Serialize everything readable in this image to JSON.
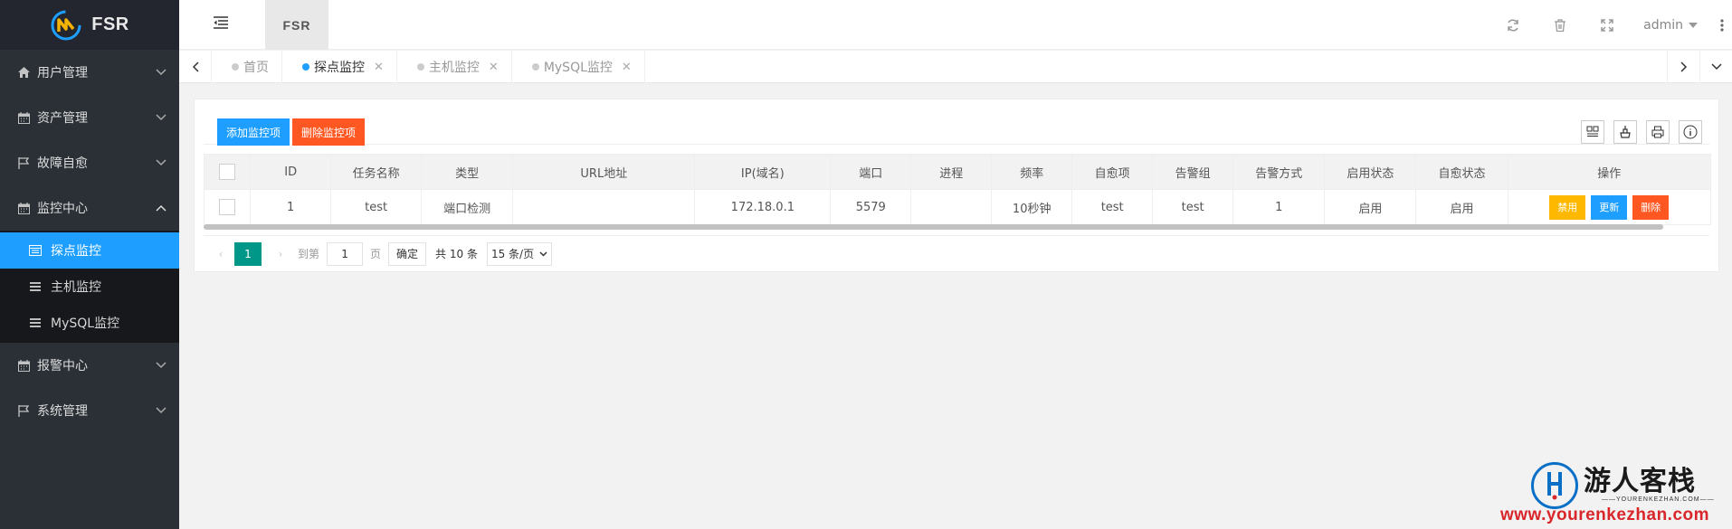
{
  "app": {
    "logo_text": "FSR",
    "site_tab": "FSR"
  },
  "sidebar": {
    "items": [
      {
        "label": "用户管理",
        "icon": "home-icon"
      },
      {
        "label": "资产管理",
        "icon": "calendar-icon"
      },
      {
        "label": "故障自愈",
        "icon": "flag-icon"
      },
      {
        "label": "监控中心",
        "icon": "calendar-icon",
        "expanded": true
      },
      {
        "label": "报警中心",
        "icon": "calendar-icon"
      },
      {
        "label": "系统管理",
        "icon": "flag-icon"
      }
    ],
    "subitems": [
      {
        "label": "探点监控",
        "active": true
      },
      {
        "label": "主机监控"
      },
      {
        "label": "MySQL监控"
      }
    ]
  },
  "header": {
    "user": "admin"
  },
  "tabs": [
    {
      "label": "首页",
      "active": false
    },
    {
      "label": "探点监控",
      "active": true
    },
    {
      "label": "主机监控",
      "active": false
    },
    {
      "label": "MySQL监控",
      "active": false
    }
  ],
  "toolbar": {
    "add_label": "添加监控项",
    "delete_label": "删除监控项"
  },
  "table": {
    "headers": [
      "ID",
      "任务名称",
      "类型",
      "URL地址",
      "IP(域名)",
      "端口",
      "进程",
      "频率",
      "自愈项",
      "告警组",
      "告警方式",
      "启用状态",
      "自愈状态",
      "操作"
    ],
    "rows": [
      {
        "id": "1",
        "name": "test",
        "type": "端口检测",
        "url": "",
        "ip": "172.18.0.1",
        "port": "5579",
        "process": "",
        "freq": "10秒钟",
        "heal_item": "test",
        "alarm_group": "test",
        "alarm_method": "1",
        "enable_status": "启用",
        "heal_status": "启用"
      }
    ],
    "actions": {
      "disable": "禁用",
      "update": "更新",
      "delete": "删除"
    }
  },
  "pager": {
    "current": "1",
    "goto_label": "到第",
    "goto_value": "1",
    "page_label": "页",
    "confirm_label": "确定",
    "total_label": "共 10 条",
    "page_size": "15 条/页"
  },
  "watermark": {
    "name": "游人客栈",
    "sub": "——YOURENKEZHAN.COM——",
    "url": "www.yourenkezhan.com"
  },
  "colors": {
    "sidebar_bg": "#2a3036",
    "active": "#1e9fff",
    "danger": "#ff5722",
    "warn": "#ffb800",
    "pager": "#009688"
  }
}
